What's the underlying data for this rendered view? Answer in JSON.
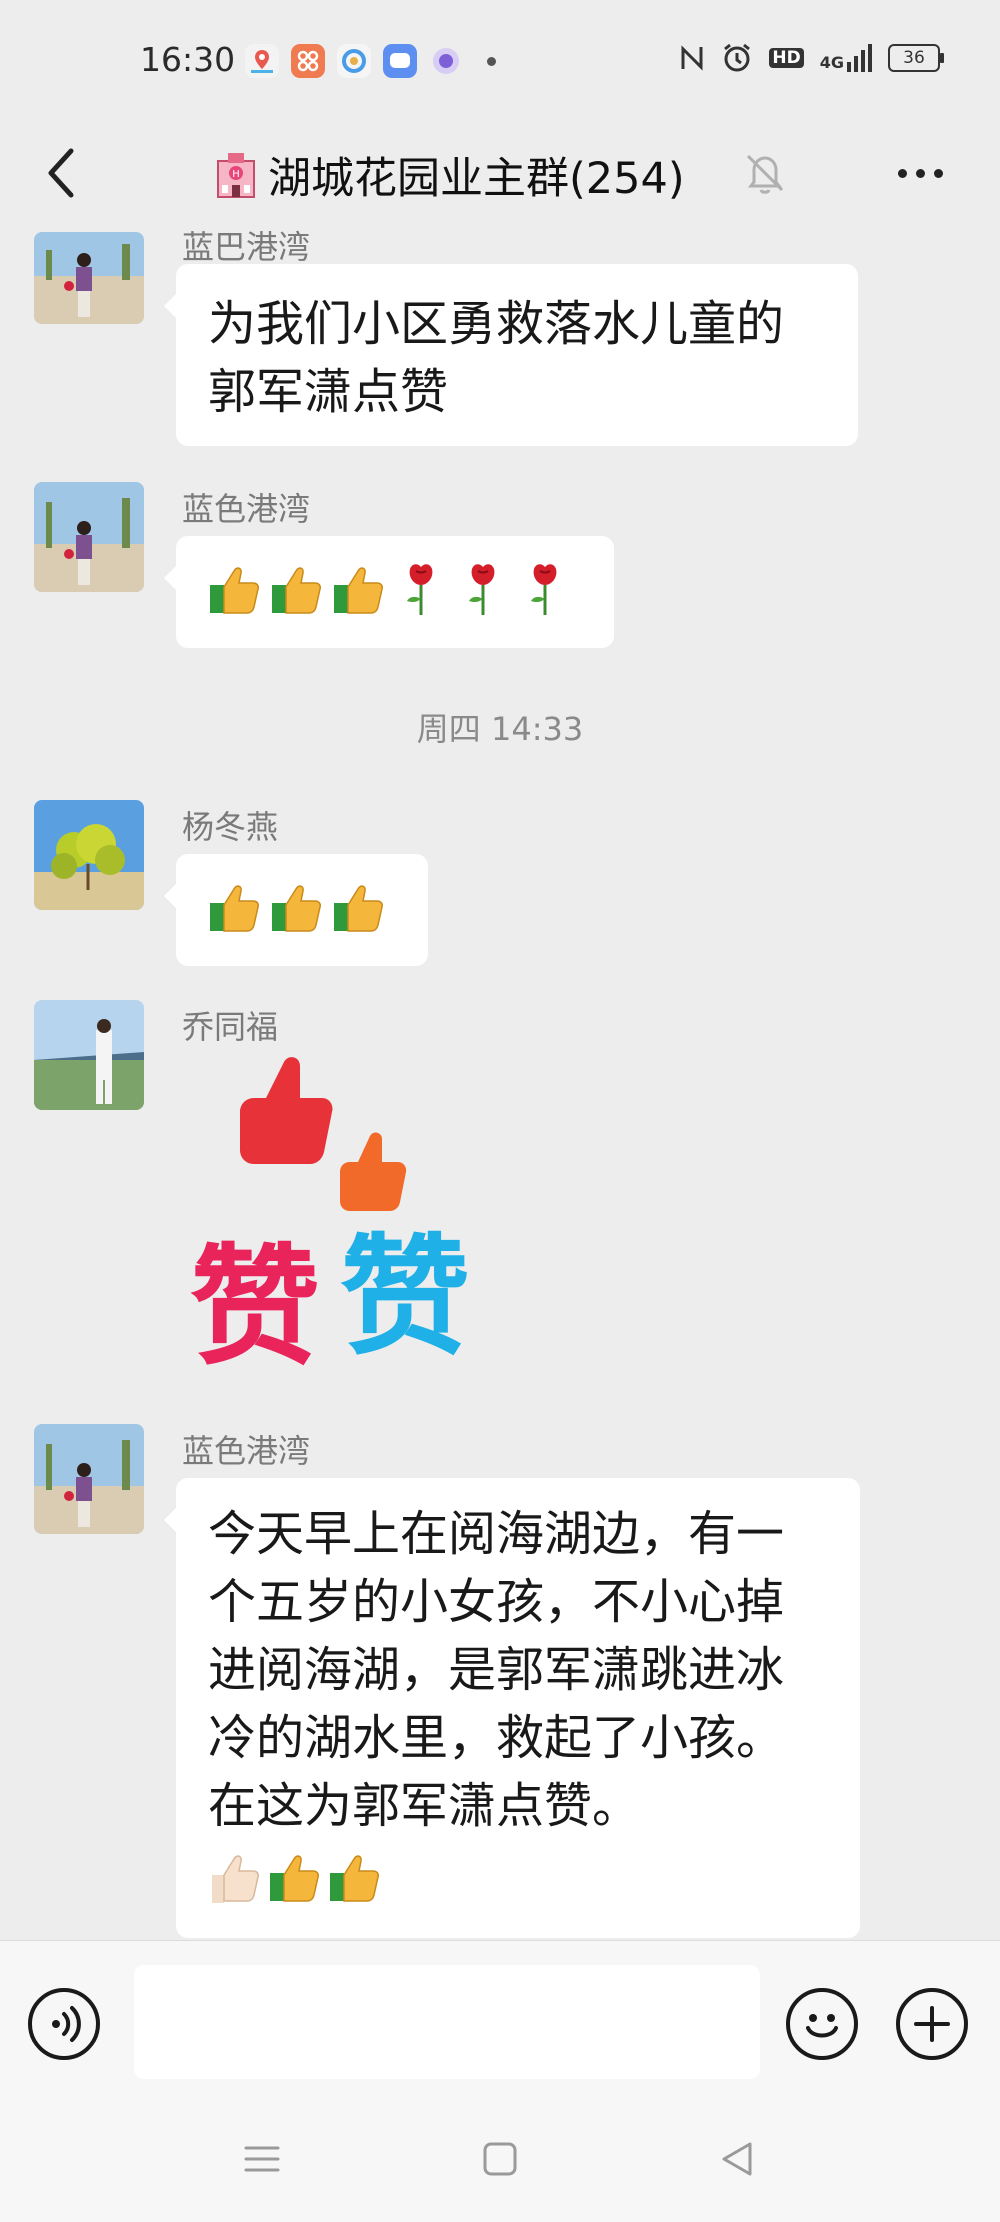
{
  "status_bar": {
    "time": "16:30",
    "network": "4G",
    "hd": "HD",
    "battery": "36",
    "left_icons": [
      "location-app-icon",
      "grid-app-icon",
      "circle-app-icon",
      "message-app-icon",
      "bubble-app-icon"
    ],
    "right_icons": [
      "nfc-icon",
      "alarm-icon",
      "hd-icon",
      "signal-icon",
      "battery-icon"
    ]
  },
  "header": {
    "title": "湖城花园业主群(254)",
    "icons": [
      "back-arrow-icon",
      "hotel-building-icon",
      "mute-bell-icon",
      "more-dots-icon"
    ]
  },
  "messages": [
    {
      "sender": "蓝巴港湾",
      "text": "为我们小区勇救落水儿童的郭军潇点赞"
    },
    {
      "sender": "蓝色港湾",
      "emojis": [
        "thumbs-up",
        "thumbs-up",
        "thumbs-up",
        "rose",
        "rose",
        "rose"
      ]
    },
    {
      "timestamp": "周四 14:33"
    },
    {
      "sender": "杨冬燕",
      "emojis": [
        "thumbs-up",
        "thumbs-up",
        "thumbs-up"
      ]
    },
    {
      "sender": "乔同福",
      "sticker": "thumbs-up-zan-sticker",
      "sticker_text": [
        "赞",
        "赞"
      ]
    },
    {
      "sender": "蓝色港湾",
      "text": "今天早上在阅海湖边，有一个五岁的小女孩，不小心掉进阅海湖，是郭军潇跳进冰冷的湖水里，救起了小孩。在这为郭军潇点赞。",
      "trailing_emojis": [
        "thumbs-up-light",
        "thumbs-up",
        "thumbs-up"
      ]
    }
  ],
  "input_bar": {
    "value": "",
    "icons": [
      "voice-icon",
      "emoji-face-icon",
      "plus-icon"
    ]
  },
  "nav_bar": {
    "icons": [
      "menu-icon",
      "home-square-icon",
      "back-triangle-icon"
    ]
  },
  "colors": {
    "background": "#ededed",
    "bubble": "#ffffff",
    "sender_text": "#7a7a7a",
    "zan_red": "#e8245a",
    "zan_blue": "#1fb0e8"
  }
}
